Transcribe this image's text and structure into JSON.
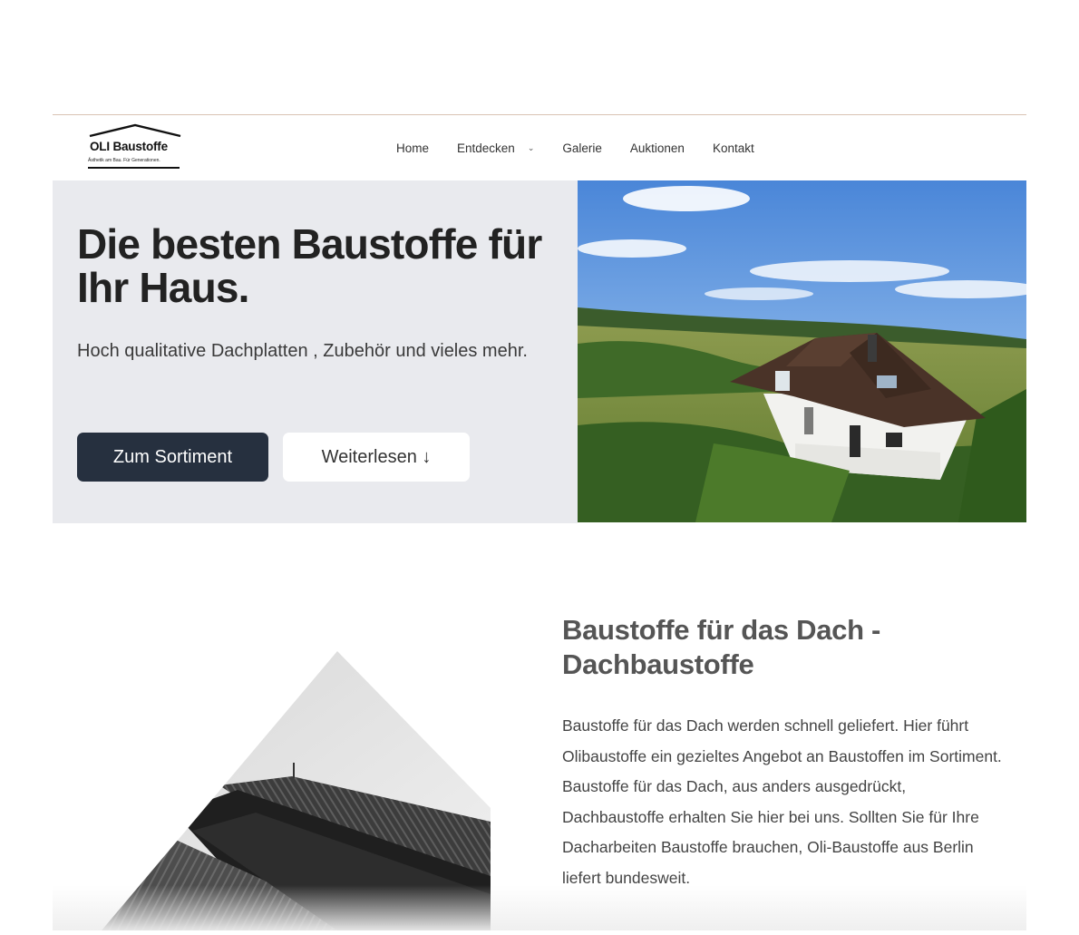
{
  "logo": {
    "name": "OLI Baustoffe",
    "tagline": "Ästhetik am Bau. Für Generationen."
  },
  "nav": {
    "items": [
      "Home",
      "Entdecken",
      "Galerie",
      "Auktionen",
      "Kontakt"
    ],
    "dropdown_icon": "chevron-down-icon"
  },
  "hero": {
    "title": "Die besten Baustoffe für Ihr Haus.",
    "subtitle": "Hoch qualitative Dachplatten , Zubehör und vieles mehr.",
    "primary_button": "Zum Sortiment",
    "secondary_button": "Weiterlesen ↓"
  },
  "section": {
    "title": "Baustoffe für das Dach - Dachbaustoffe",
    "text": "Baustoffe für das Dach werden schnell geliefert. Hier führt Olibaustoffe ein gezieltes Angebot an Baustoffen im Sortiment. Baustoffe für das Dach, aus anders ausgedrückt, Dachbaustoffe erhalten Sie hier bei uns. Sollten Sie für Ihre Dacharbeiten Baustoffe brauchen, Oli-Baustoffe aus Berlin liefert bundesweit."
  },
  "colors": {
    "primary_button": "#26303f",
    "hero_background": "#e9eaee",
    "divider": "#d9c3b3"
  }
}
